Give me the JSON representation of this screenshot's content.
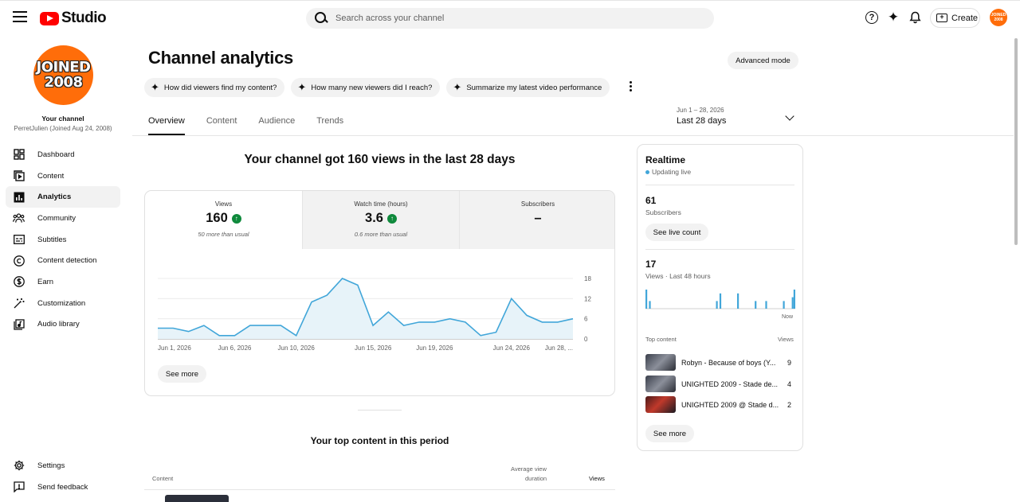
{
  "topbar": {
    "logo_text": "Studio",
    "search_placeholder": "Search across your channel",
    "create_label": "Create",
    "avatar_text": "JOINED 2008"
  },
  "sidebar": {
    "avatar_text_line1": "JOINED",
    "avatar_text_line2": "2008",
    "your_channel": "Your channel",
    "channel_name": "PerretJulien (Joined Aug 24, 2008)",
    "items": [
      {
        "label": "Dashboard",
        "icon": "dashboard-icon"
      },
      {
        "label": "Content",
        "icon": "content-icon"
      },
      {
        "label": "Analytics",
        "icon": "analytics-icon"
      },
      {
        "label": "Community",
        "icon": "community-icon"
      },
      {
        "label": "Subtitles",
        "icon": "subtitles-icon"
      },
      {
        "label": "Content detection",
        "icon": "copyright-icon"
      },
      {
        "label": "Earn",
        "icon": "dollar-icon"
      },
      {
        "label": "Customization",
        "icon": "magic-wand-icon"
      },
      {
        "label": "Audio library",
        "icon": "audio-library-icon"
      }
    ],
    "bottom": [
      {
        "label": "Settings",
        "icon": "gear-icon"
      },
      {
        "label": "Send feedback",
        "icon": "feedback-icon"
      }
    ]
  },
  "page": {
    "title": "Channel analytics",
    "advanced_mode": "Advanced mode",
    "chips": [
      "How did viewers find my content?",
      "How many new viewers did I reach?",
      "Summarize my latest video performance"
    ],
    "tabs": [
      "Overview",
      "Content",
      "Audience",
      "Trends"
    ],
    "date_range_small": "Jun 1 – 28, 2026",
    "date_range_big": "Last 28 days",
    "headline": "Your channel got 160 views in the last 28 days"
  },
  "metrics": [
    {
      "label": "Views",
      "value": "160",
      "sub": "50 more than usual"
    },
    {
      "label": "Watch time (hours)",
      "value": "3.6",
      "sub": "0.6 more than usual"
    },
    {
      "label": "Subscribers",
      "value": "–",
      "sub": ""
    }
  ],
  "chart_data": {
    "type": "area",
    "x": [
      "Jun 1",
      "Jun 2",
      "Jun 3",
      "Jun 4",
      "Jun 5",
      "Jun 6",
      "Jun 7",
      "Jun 8",
      "Jun 9",
      "Jun 10",
      "Jun 11",
      "Jun 12",
      "Jun 13",
      "Jun 14",
      "Jun 15",
      "Jun 16",
      "Jun 17",
      "Jun 18",
      "Jun 19",
      "Jun 20",
      "Jun 21",
      "Jun 22",
      "Jun 23",
      "Jun 24",
      "Jun 25",
      "Jun 26",
      "Jun 27",
      "Jun 28"
    ],
    "y": [
      3.2,
      3.2,
      2.2,
      4,
      1,
      1,
      4,
      4,
      4,
      1,
      11,
      13,
      18,
      16,
      4,
      8,
      4,
      5,
      5,
      6,
      5,
      1,
      2,
      12,
      7,
      5,
      5,
      6
    ],
    "ylim": [
      0,
      18
    ],
    "yticks": [
      "18",
      "12",
      "6",
      "0"
    ],
    "xtick_labels": [
      "Jun 1, 2026",
      "Jun 6, 2026",
      "Jun 10, 2026",
      "Jun 15, 2026",
      "Jun 19, 2026",
      "Jun 24, 2026",
      "Jun 28, ..."
    ],
    "line_color": "#41a6d9",
    "fill_color": "#e7f3f9"
  },
  "overview_see_more": "See more",
  "top_content": {
    "title": "Your top content in this period",
    "col_content": "Content",
    "col_avd_1": "Average view",
    "col_avd_2": "duration",
    "col_views": "Views"
  },
  "realtime": {
    "title": "Realtime",
    "live": "Updating live",
    "subs_value": "61",
    "subs_label": "Subscribers",
    "see_live_count": "See live count",
    "views_value": "17",
    "views_label": "Views · Last 48 hours",
    "bars": [
      5,
      0,
      2,
      0,
      0,
      0,
      0,
      0,
      0,
      0,
      0,
      0,
      0,
      0,
      0,
      0,
      0,
      0,
      0,
      0,
      0,
      0,
      0,
      0,
      0,
      0,
      0,
      0,
      0,
      0,
      0,
      0,
      0,
      0,
      0,
      0,
      0,
      0,
      0,
      0,
      2,
      0,
      4,
      0,
      0,
      0,
      0,
      0,
      0,
      0,
      0,
      0,
      4,
      0,
      0,
      0,
      0,
      0,
      0,
      0,
      0,
      0,
      2,
      0,
      0,
      0,
      0,
      0,
      2,
      0,
      0,
      0,
      0,
      0,
      0,
      0,
      0,
      0,
      2,
      0,
      0,
      0,
      0,
      3,
      5
    ],
    "now_label": "Now",
    "top_content_label": "Top content",
    "views_col": "Views",
    "rows": [
      {
        "title": "Robyn - Because of boys (Y...",
        "views": "9"
      },
      {
        "title": "UNIGHTED 2009 - Stade de...",
        "views": "4"
      },
      {
        "title": "UNIGHTED 2009 @ Stade d...",
        "views": "2"
      }
    ],
    "see_more": "See more"
  }
}
